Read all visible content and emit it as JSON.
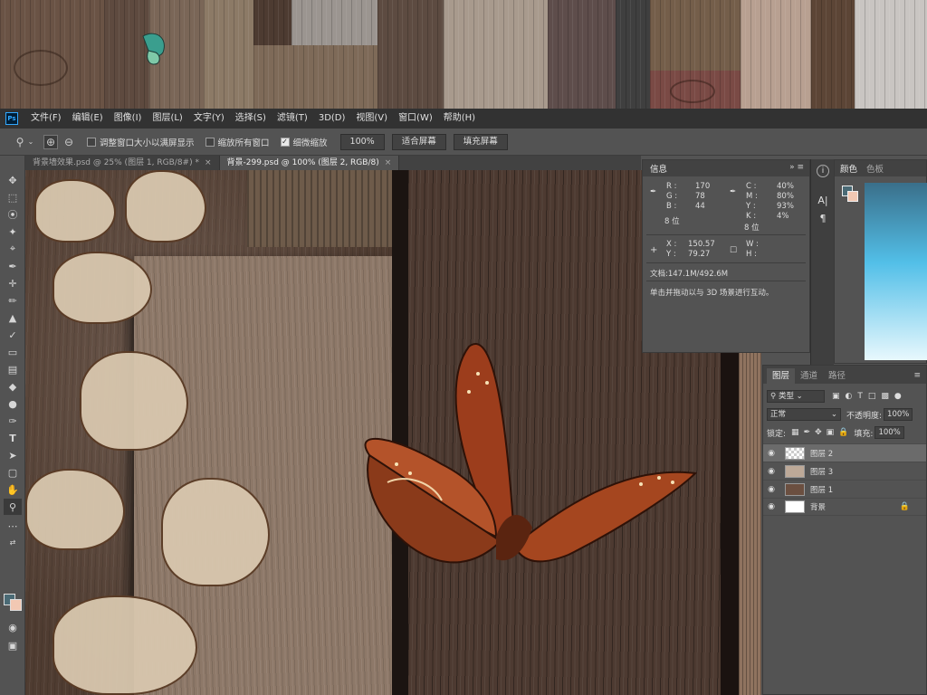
{
  "window": {
    "app_icon": "Ps",
    "menu": [
      "文件(F)",
      "编辑(E)",
      "图像(I)",
      "图层(L)",
      "文字(Y)",
      "选择(S)",
      "滤镜(T)",
      "3D(D)",
      "视图(V)",
      "窗口(W)",
      "帮助(H)"
    ]
  },
  "options_bar": {
    "tool_icon": "zoom-icon",
    "resize_windows": "调整窗口大小以满屏显示",
    "zoom_all_windows": "缩放所有窗口",
    "scrubby_zoom": "细微缩放",
    "zoom_value": "100%",
    "fit_screen": "适合屏幕",
    "fill_screen": "填充屏幕"
  },
  "tabs": [
    {
      "label": "背景墙效果.psd @ 25% (图层 1, RGB/8#) *",
      "active": false
    },
    {
      "label": "背景-299.psd @ 100% (图层 2, RGB/8)",
      "active": true
    }
  ],
  "info_panel": {
    "title": "信息",
    "rgb": {
      "r_label": "R :",
      "r": "170",
      "g_label": "G :",
      "g": "78",
      "b_label": "B :",
      "b": "44",
      "depth": "8 位"
    },
    "cmyk": {
      "c_label": "C :",
      "c": "40%",
      "m_label": "M :",
      "m": "80%",
      "y_label": "Y :",
      "y": "93%",
      "k_label": "K :",
      "k": "4%",
      "depth": "8 位"
    },
    "coords": {
      "x_label": "X :",
      "x": "150.57",
      "y_label": "Y :",
      "y": "79.27",
      "w_label": "W :",
      "h_label": "H :"
    },
    "doc": "文档:147.1M/492.6M",
    "hint": "单击并拖动以与 3D 场景进行互动。"
  },
  "color_panel": {
    "tabs": [
      "颜色",
      "色板"
    ],
    "fg_color": "#4a6a75",
    "bg_color": "#f2c8b3"
  },
  "layers_panel": {
    "tabs": [
      "图层",
      "通道",
      "路径"
    ],
    "filter_kind": "类型",
    "blend_mode": "正常",
    "opacity_label": "不透明度:",
    "opacity": "100%",
    "lock_label": "锁定:",
    "fill_label": "填充:",
    "fill": "100%",
    "layers": [
      {
        "name": "图层 2",
        "selected": true,
        "locked": false
      },
      {
        "name": "图层 3",
        "selected": false,
        "locked": false
      },
      {
        "name": "图层 1",
        "selected": false,
        "locked": false
      },
      {
        "name": "背景",
        "selected": false,
        "locked": true
      }
    ]
  }
}
